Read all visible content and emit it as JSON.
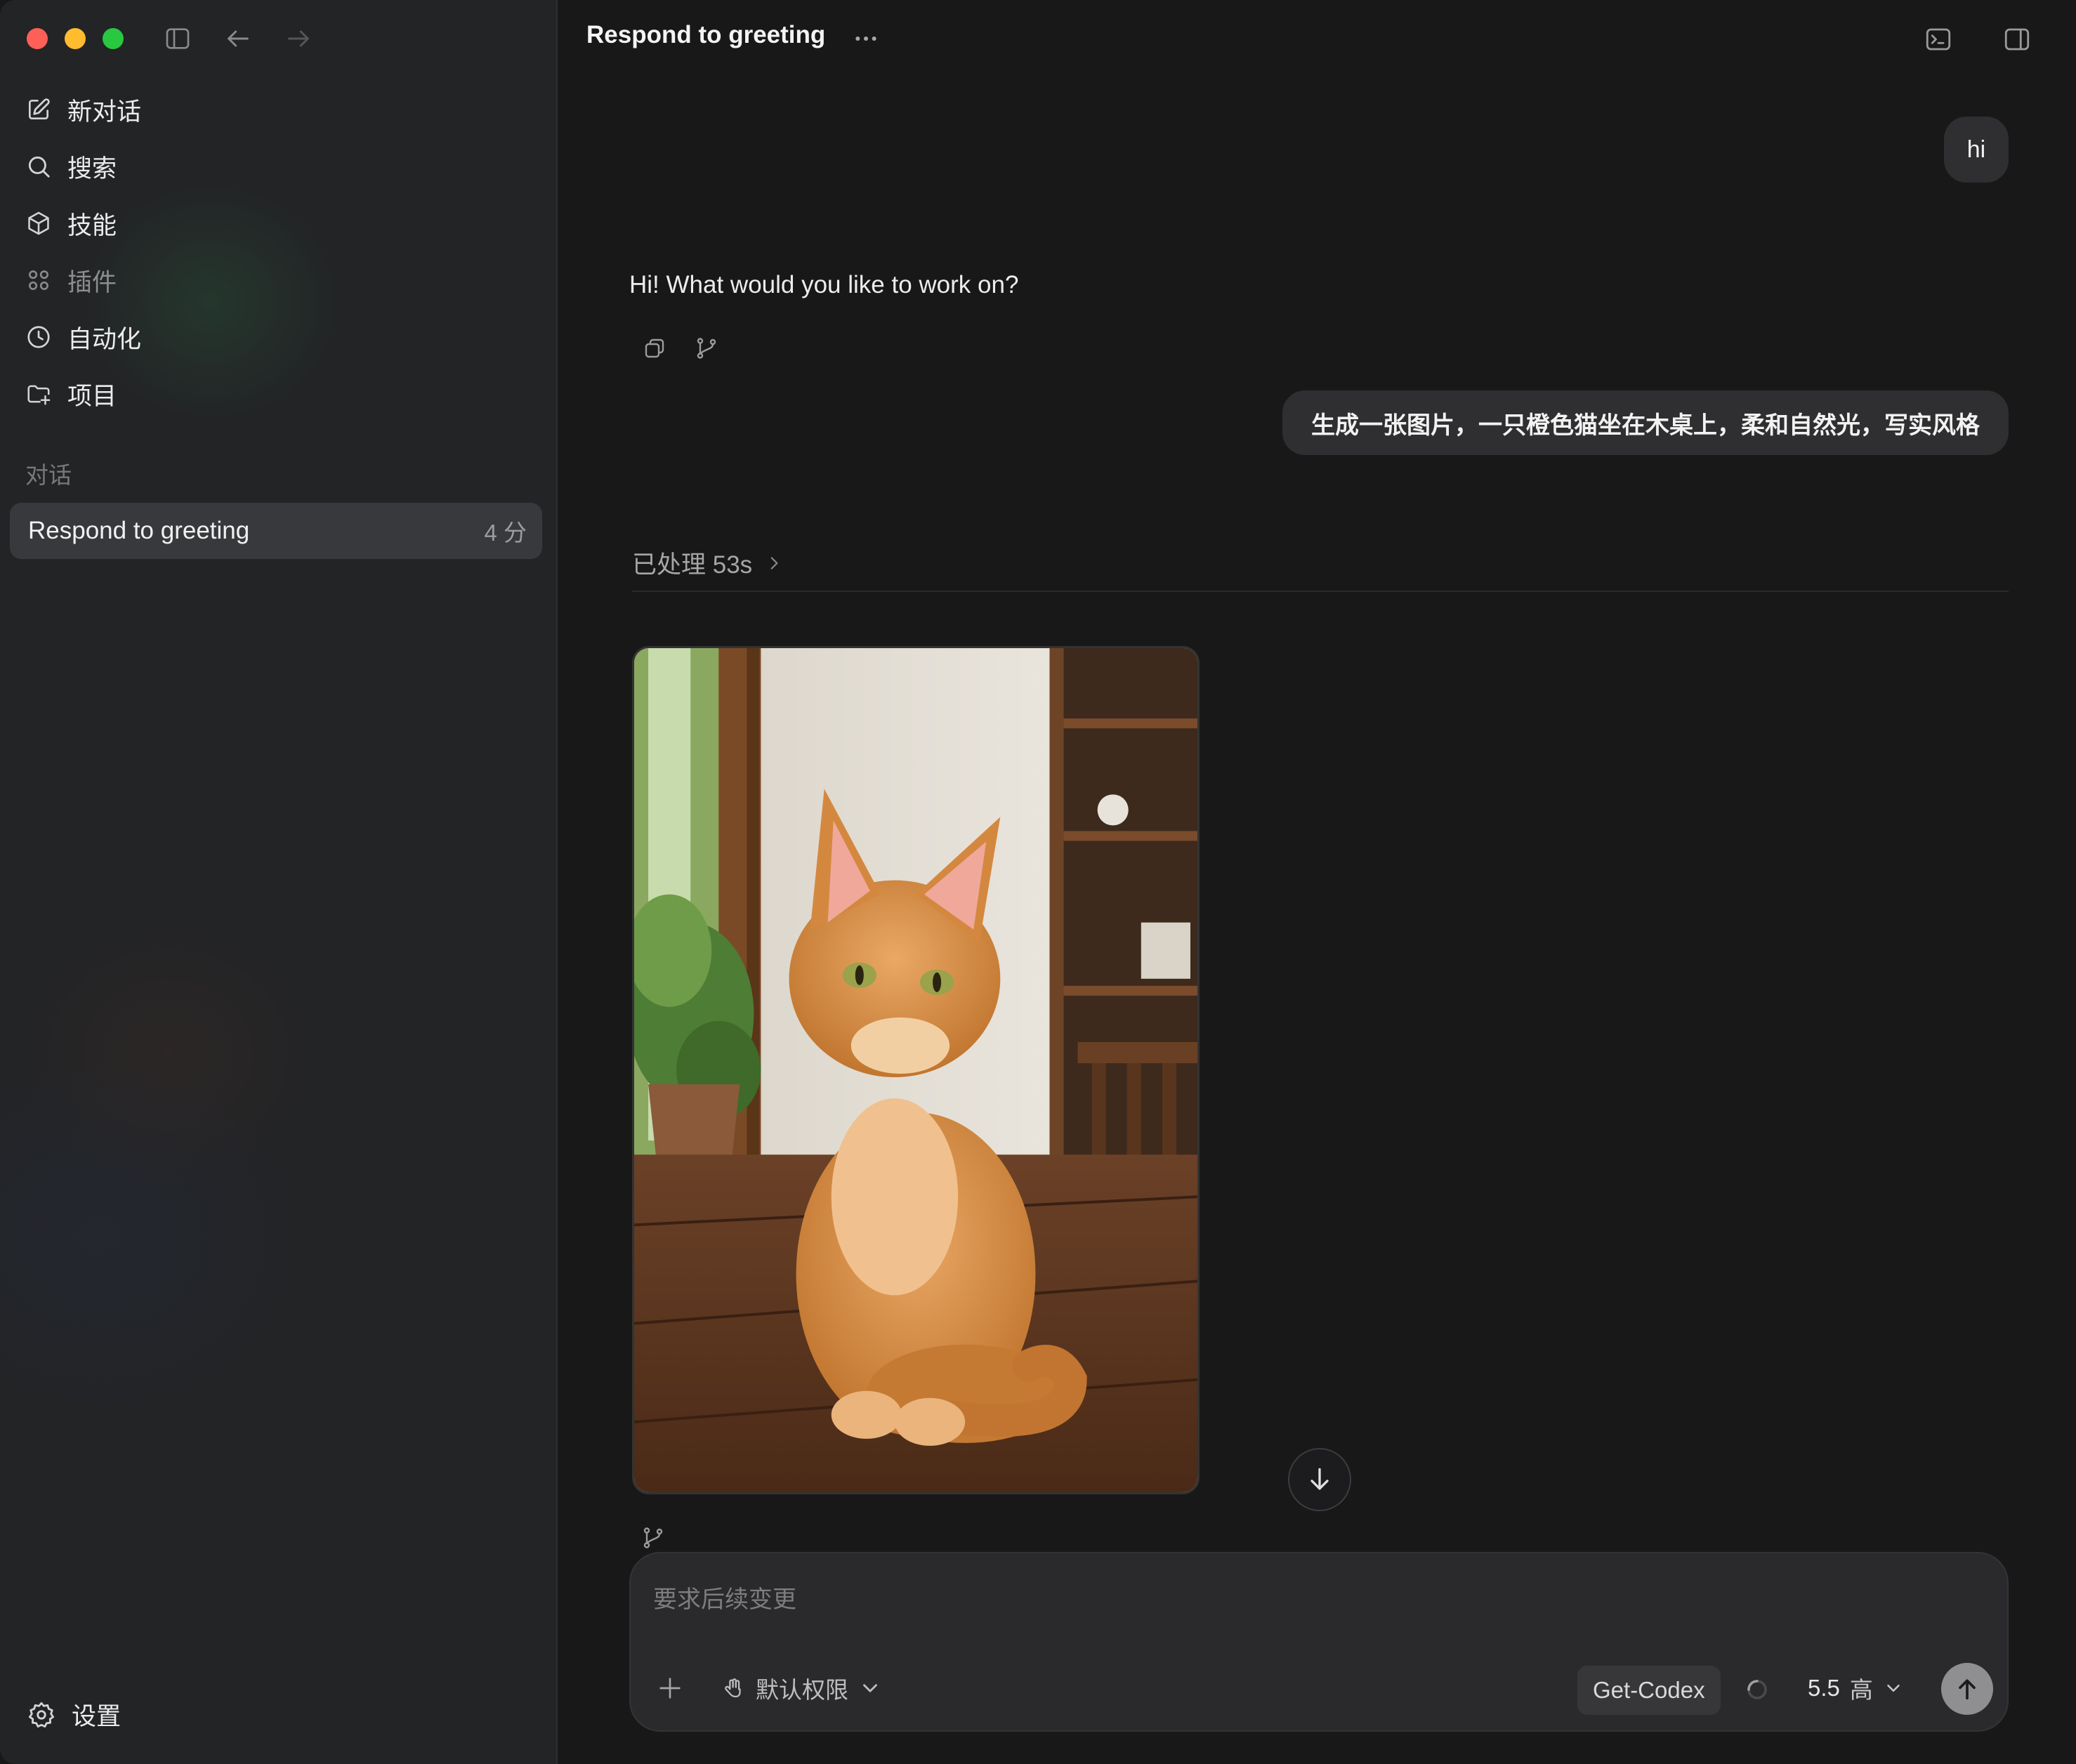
{
  "window": {
    "traffic_lights": [
      "close",
      "minimize",
      "zoom"
    ],
    "title": "Respond to greeting"
  },
  "sidebar": {
    "nav": [
      {
        "label": "新对话",
        "icon": "compose-icon"
      },
      {
        "label": "搜索",
        "icon": "search-icon"
      },
      {
        "label": "技能",
        "icon": "cube-icon"
      },
      {
        "label": "插件",
        "icon": "grid-icon"
      },
      {
        "label": "自动化",
        "icon": "clock-icon"
      },
      {
        "label": "项目",
        "icon": "folder-plus-icon"
      }
    ],
    "section_label": "对话",
    "conversations": [
      {
        "title": "Respond to greeting",
        "age": "4 分"
      }
    ],
    "settings_label": "设置"
  },
  "chat": {
    "messages": [
      {
        "role": "user",
        "text": "hi"
      },
      {
        "role": "assistant",
        "text": "Hi! What would you like to work on?"
      },
      {
        "role": "user",
        "text": "生成一张图片，一只橙色猫坐在木桌上，柔和自然光，写实风格"
      }
    ],
    "processed_label": "已处理 53s",
    "generated_image": "orange cat sitting on wooden table"
  },
  "composer": {
    "placeholder": "要求后续变更",
    "permission_label": "默认权限",
    "tool_chip": "Get-Codex",
    "model": "5.5",
    "reasoning_level": "高"
  },
  "colors": {
    "background": "#181818",
    "sidebar": "#232426",
    "bubble": "#2f2f31",
    "send_button": "#8f8f92"
  }
}
